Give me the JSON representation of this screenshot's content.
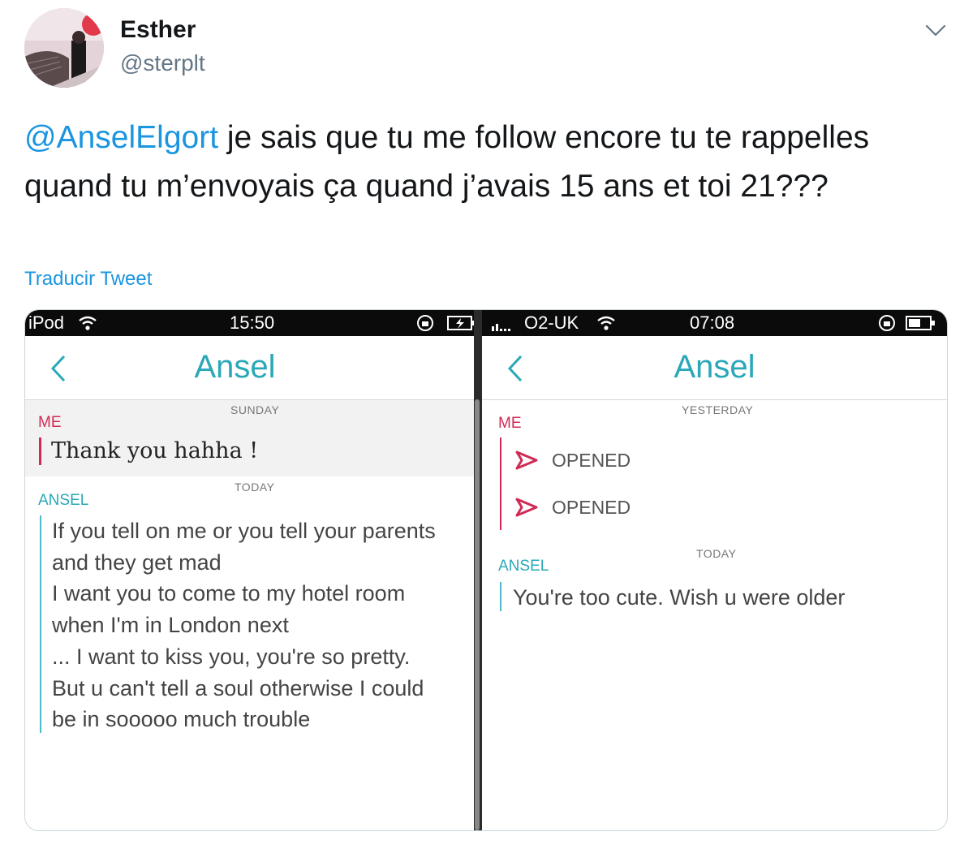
{
  "tweet": {
    "author_name": "Esther",
    "author_handle": "@sterplt",
    "mention": "@AnselElgort",
    "text_after_mention": " je sais que tu me follow encore tu te rappelles quand tu m’envoyais ça quand j’avais 15 ans et toi 21???",
    "translate_label": "Traducir Tweet",
    "icons": [
      "avatar-photo",
      "chevron-down-icon"
    ],
    "colors": {
      "link": "#1b95e0",
      "text": "#14171a",
      "handle": "#657786"
    }
  },
  "screenshots": {
    "left": {
      "status": {
        "carrier": "iPod",
        "time": "15:50"
      },
      "title": "Ansel",
      "day1": "SUNDAY",
      "sender_me": "ME",
      "me_message": "Thank you hahha !",
      "day2": "TODAY",
      "sender_ansel": "ANSEL",
      "ansel_lines": [
        "If you tell on me or you tell your parents",
        "and they get mad",
        "I want you to come to my hotel room",
        "when I'm in London next",
        "... I want to kiss you, you're so pretty.",
        "But u can't tell a soul otherwise I could",
        "be in sooooo much trouble"
      ]
    },
    "right": {
      "status": {
        "carrier": "O2-UK",
        "time": "07:08"
      },
      "title": "Ansel",
      "day1": "YESTERDAY",
      "sender_me": "ME",
      "opened_1": "OPENED",
      "opened_2": "OPENED",
      "day2": "TODAY",
      "sender_ansel": "ANSEL",
      "ansel_message": "You're too cute. Wish u were older"
    },
    "colors": {
      "accent": "#2aa8b8",
      "me": "#d02b55"
    }
  }
}
